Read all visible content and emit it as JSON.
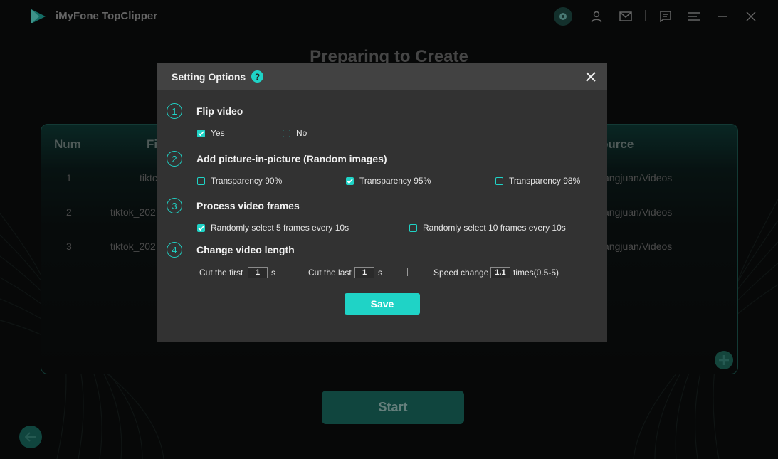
{
  "app": {
    "title": "iMyFone TopClipper"
  },
  "page": {
    "title": "Preparing to Create"
  },
  "table": {
    "headers": [
      "Num",
      "Fi",
      "ource"
    ],
    "rows": [
      {
        "num": "1",
        "file": "tiktc",
        "source": "angjuan/Videos"
      },
      {
        "num": "2",
        "file": "tiktok_202",
        "source": "angjuan/Videos"
      },
      {
        "num": "3",
        "file": "tiktok_202",
        "source": "angjuan/Videos"
      }
    ]
  },
  "start_button": "Start",
  "modal": {
    "title": "Setting Options",
    "help": "?",
    "sections": [
      {
        "num": "1",
        "title": "Flip video",
        "options": [
          {
            "label": "Yes",
            "checked": true
          },
          {
            "label": "No",
            "checked": false
          }
        ]
      },
      {
        "num": "2",
        "title": "Add picture-in-picture (Random images)",
        "options": [
          {
            "label": "Transparency 90%",
            "checked": false
          },
          {
            "label": "Transparency 95%",
            "checked": true
          },
          {
            "label": "Transparency 98%",
            "checked": false
          }
        ]
      },
      {
        "num": "3",
        "title": "Process video frames",
        "options": [
          {
            "label": "Randomly select 5 frames every 10s",
            "checked": true
          },
          {
            "label": "Randomly select 10 frames every 10s",
            "checked": false
          }
        ]
      },
      {
        "num": "4",
        "title": "Change video length"
      }
    ],
    "length": {
      "cut_first_label": "Cut the first",
      "cut_first_value": "1",
      "cut_first_unit": "s",
      "cut_last_label": "Cut the last",
      "cut_last_value": "1",
      "cut_last_unit": "s",
      "speed_label": "Speed change",
      "speed_value": "1.1",
      "speed_unit": "times(0.5-5)"
    },
    "save": "Save"
  },
  "colors": {
    "accent": "#1fd3c6",
    "modal_bg": "#323232",
    "header_bg": "#424242"
  },
  "icons": [
    "logo-icon",
    "settings-icon",
    "user-icon",
    "mail-icon",
    "feedback-icon",
    "menu-icon",
    "minimize-icon",
    "close-icon",
    "help-icon",
    "modal-close-icon",
    "add-icon",
    "back-arrow-icon",
    "check-icon"
  ]
}
